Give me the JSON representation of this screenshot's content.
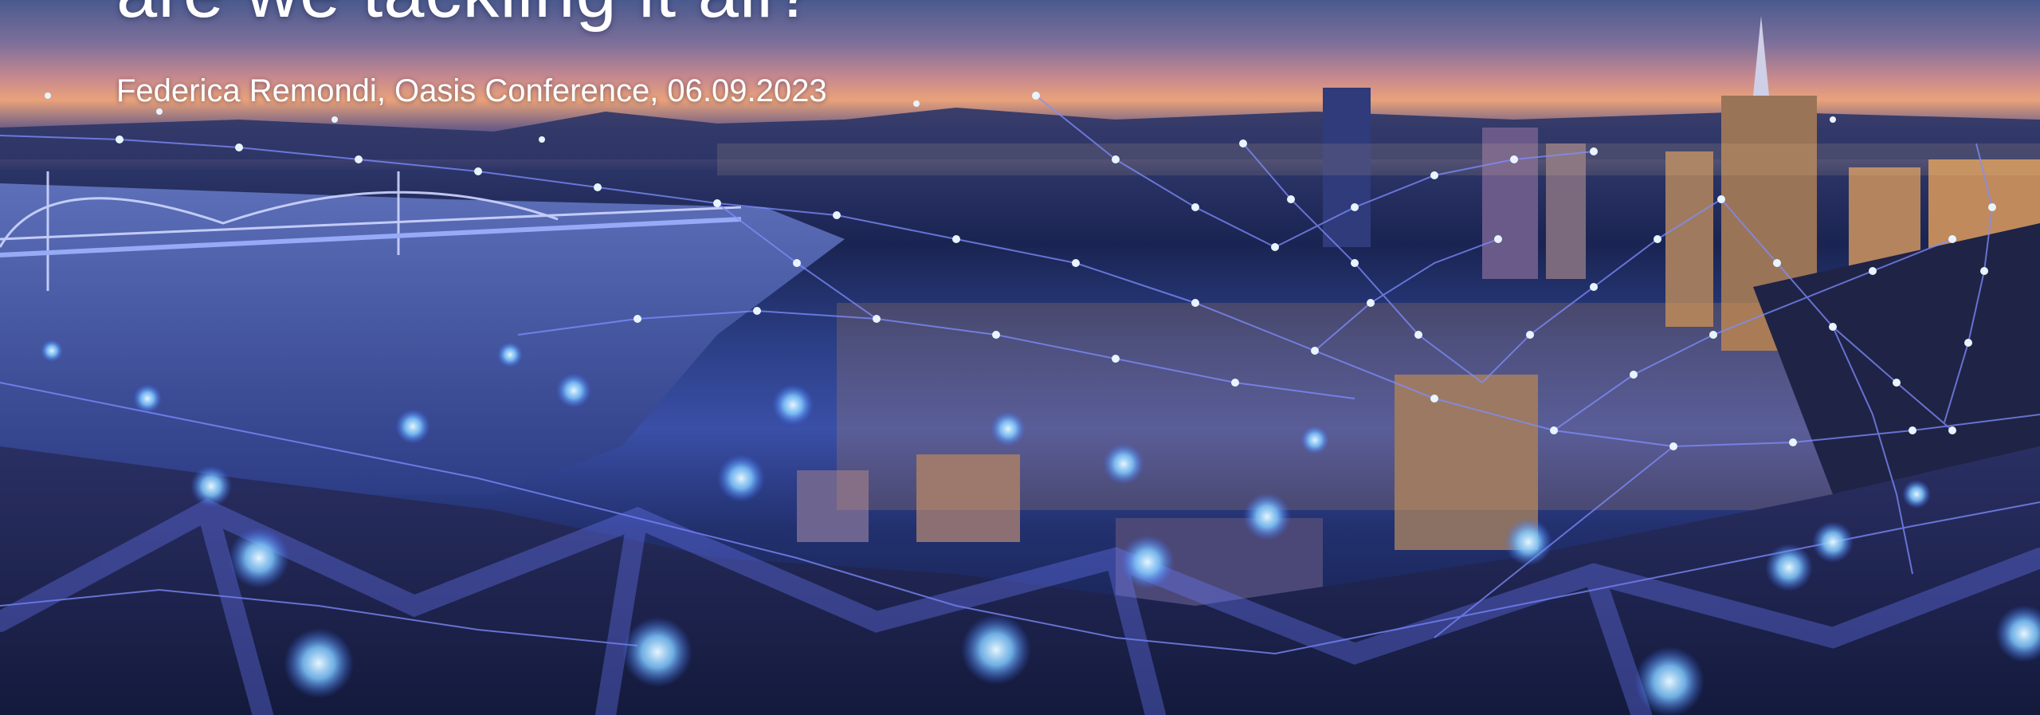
{
  "slide": {
    "headline": "are we tackling it all?",
    "byline": "Federica Remondi, Oasis Conference, 06.09.2023"
  },
  "background": {
    "image_description_icon": "city-night-network-photo",
    "accent_color": "#5a7dff",
    "node_color": "#9fd4ff"
  }
}
